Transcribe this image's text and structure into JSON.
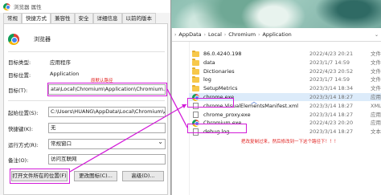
{
  "props_dialog": {
    "title": "浏览器 属性",
    "tabs": [
      "常规",
      "快捷方式",
      "兼容性",
      "安全",
      "详细信息",
      "以前的版本"
    ],
    "app_name": "浏览器",
    "target_type_label": "目标类型:",
    "target_type_value": "应用程序",
    "target_location_label": "目标位置:",
    "target_location_value": "Application",
    "target_label": "目标(T):",
    "target_value": "ata\\Local\\Chromium\\Application\\Chromium.exe",
    "start_in_label": "起始位置(S):",
    "start_in_value": "C:\\Users\\HUANG\\AppData\\Local\\Chromium\\App",
    "shortcut_key_label": "快捷键(K):",
    "shortcut_key_value": "无",
    "run_label": "运行方式(R):",
    "run_value": "常规窗口",
    "comment_label": "备注(O):",
    "comment_value": "访问互联网",
    "open_location_button": "打开文件所在的位置(F)",
    "change_icon_button": "更改图标(C)...",
    "advanced_button": "高级(D)..."
  },
  "annotations": {
    "target_note": "原默认路径",
    "bottom_note": "把改复制过来，然后修改到一下这个路径下！！！"
  },
  "explorer": {
    "breadcrumb": [
      "AppData",
      "Local",
      "Chromium",
      "Application"
    ],
    "files": [
      {
        "name": "86.0.4240.198",
        "date": "2022/4/23 20:21",
        "type": "文件",
        "icon": "folder-icon"
      },
      {
        "name": "data",
        "date": "2023/1/7 14:59",
        "type": "文件",
        "icon": "folder-icon"
      },
      {
        "name": "Dictionaries",
        "date": "2022/4/23 20:52",
        "type": "文件",
        "icon": "folder-icon"
      },
      {
        "name": "log",
        "date": "2023/1/7 14:59",
        "type": "文件",
        "icon": "folder-icon"
      },
      {
        "name": "SetupMetrics",
        "date": "2023/3/14 18:34",
        "type": "文件",
        "icon": "folder-icon"
      },
      {
        "name": "chrome.exe",
        "date": "2023/3/14 18:27",
        "type": "应用",
        "icon": "chromium-icon"
      },
      {
        "name": "chrome.VisualElementsManifest.xml",
        "date": "2023/3/14 18:27",
        "type": "XML 清文件",
        "icon": "document-icon"
      },
      {
        "name": "chrome_proxy.exe",
        "date": "2023/3/14 18:27",
        "type": "应用",
        "icon": "document-icon"
      },
      {
        "name": "Chromium.exe",
        "date": "2022/4/23 20:20",
        "type": "应用",
        "icon": "chromium-icon"
      },
      {
        "name": "debug.log",
        "date": "2023/3/14 18:27",
        "type": "文本",
        "icon": "document-icon"
      }
    ]
  },
  "colors": {
    "annotation_box": "#d21bd8",
    "annotation_text": "#e0201f",
    "selection": "#dcebfa"
  }
}
